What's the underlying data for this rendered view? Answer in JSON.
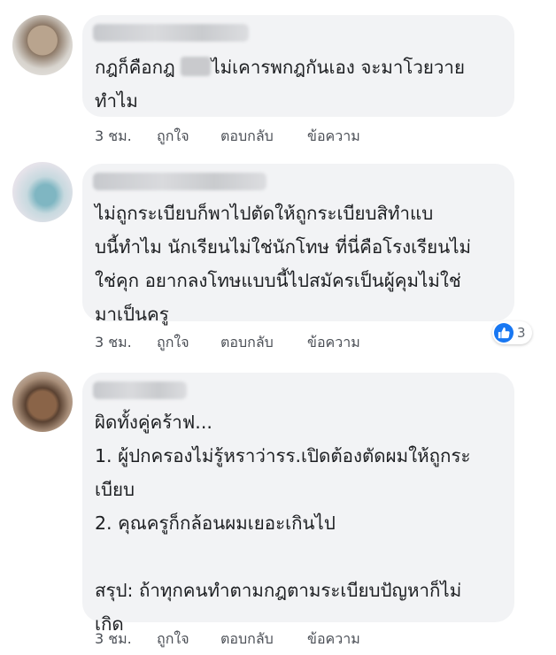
{
  "comments": [
    {
      "author": "",
      "lines": [
        "กฎก็คือกฎ ",
        "ไม่เคารพกฎกันเอง จะมาโวยวาย",
        "ทำไม"
      ],
      "time": "3 ชม.",
      "like": "ถูกใจ",
      "reply": "ตอบกลับ",
      "message": "ข้อความ"
    },
    {
      "author": "",
      "text": "ไม่ถูกระเบียบก็พาไปตัดให้ถูกระเบียบสิทำแบ\nบนี้ทำไม นักเรียนไม่ใช่นักโทษ ที่นี่คือโรงเรียนไม่\nใช่คุก อยากลงโทษแบบนี้ไปสมัครเป็นผู้คุมไม่ใช่\nมาเป็นครู",
      "time": "3 ชม.",
      "like": "ถูกใจ",
      "reply": "ตอบกลับ",
      "message": "ข้อความ",
      "reaction_count": "3",
      "reaction_icon": "like-thumb-icon",
      "reaction_color": "#1877f2"
    },
    {
      "author": "",
      "text": "ผิดทั้งคู่คร้าฟ...\n1. ผู้ปกครองไม่รู้หราว่ารร.เปิดต้องตัดผมให้ถูกระ\nเบียบ\n2. คุณครูก็กล้อนผมเยอะเกินไป\n\nสรุป: ถ้าทุกคนทำตามกฎตามระเบียบปัญหาก็ไม่\nเกิด",
      "time": "3 ชม.",
      "like": "ถูกใจ",
      "reply": "ตอบกลับ",
      "message": "ข้อความ"
    }
  ],
  "colors": {
    "bubble": "#f2f3f5",
    "text": "#1c1e21",
    "meta": "#4b4f56",
    "accent": "#1877f2"
  }
}
